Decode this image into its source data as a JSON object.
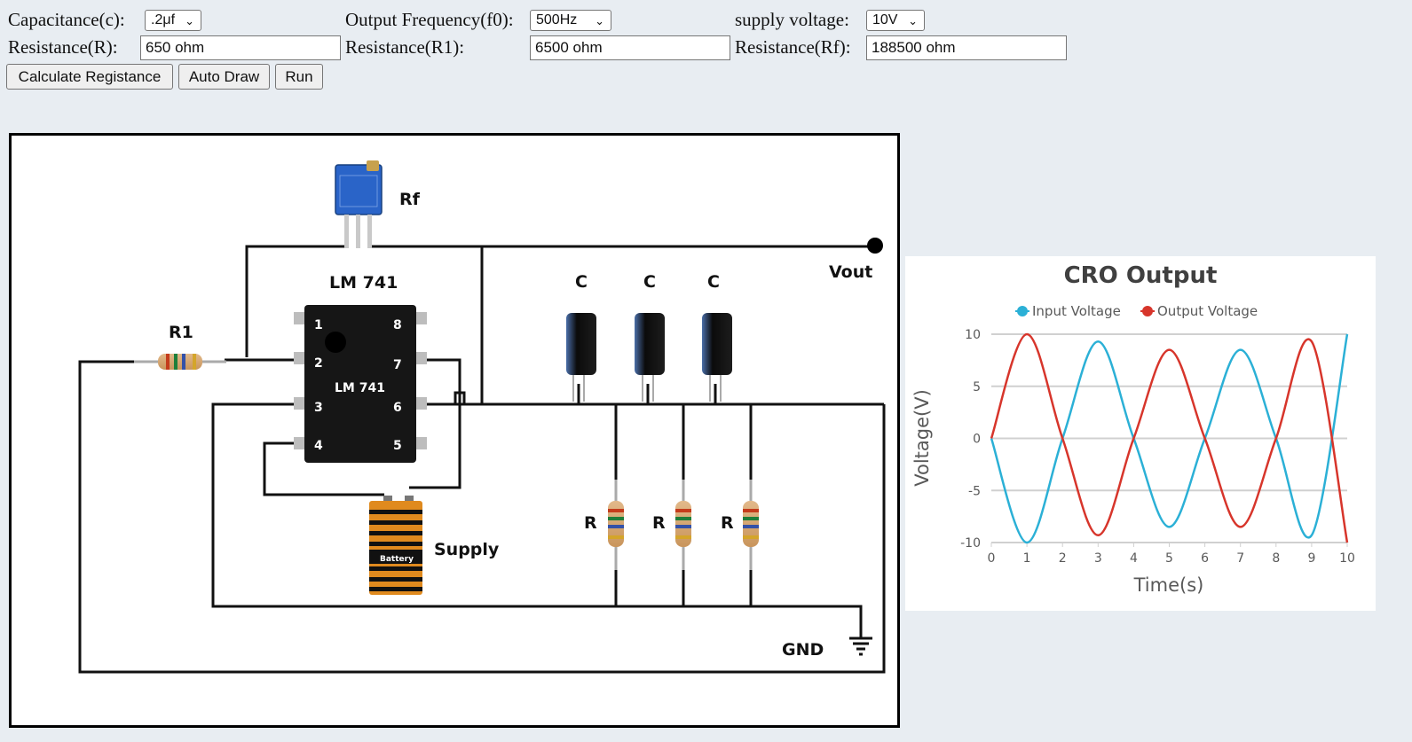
{
  "controls": {
    "capacitance": {
      "label": "Capacitance(c):",
      "value": ".2μf"
    },
    "frequency": {
      "label": "Output Frequency(f0):",
      "value": "500Hz"
    },
    "voltage": {
      "label": "supply voltage:",
      "value": "10V"
    },
    "resistance_r": {
      "label": "Resistance(R):",
      "value": "650 ohm"
    },
    "resistance_r1": {
      "label": "Resistance(R1):",
      "value": "6500 ohm"
    },
    "resistance_rf": {
      "label": "Resistance(Rf):",
      "value": "188500 ohm"
    }
  },
  "buttons": {
    "calculate": "Calculate Registance",
    "auto_draw": "Auto Draw",
    "run": "Run"
  },
  "circuit": {
    "rf_label": "Rf",
    "ic_title": "LM 741",
    "ic_body": "LM 741",
    "pins_left": [
      "1",
      "2",
      "3",
      "4"
    ],
    "pins_right": [
      "8",
      "7",
      "6",
      "5"
    ],
    "r1_label": "R1",
    "vout_label": "Vout",
    "c_labels": [
      "C",
      "C",
      "C"
    ],
    "r_labels": [
      "R",
      "R",
      "R"
    ],
    "supply_label": "Supply",
    "battery_text": "Battery",
    "gnd_label": "GND"
  },
  "chart_data": {
    "type": "line",
    "title": "CRO Output",
    "xlabel": "Time(s)",
    "ylabel": "Voltage(V)",
    "xlim": [
      0,
      10
    ],
    "ylim": [
      -10,
      10
    ],
    "xticks": [
      "0",
      "1",
      "2",
      "3",
      "4",
      "5",
      "6",
      "7",
      "8",
      "9",
      "10"
    ],
    "yticks": [
      "10",
      "5",
      "0",
      "-5",
      "-10"
    ],
    "grid": true,
    "legend_position": "top",
    "series": [
      {
        "name": "Input Voltage",
        "color": "#2bb0d6",
        "x": [
          0,
          1,
          2,
          3,
          4,
          5,
          6,
          7,
          8,
          9,
          10
        ],
        "y": [
          0,
          -10,
          0,
          9.3,
          0,
          -8.5,
          0,
          8.5,
          0,
          -9.3,
          10
        ]
      },
      {
        "name": "Output Voltage",
        "color": "#d7352b",
        "x": [
          0,
          1,
          2,
          3,
          4,
          5,
          6,
          7,
          8,
          9,
          10
        ],
        "y": [
          0,
          10,
          0,
          -9.3,
          0,
          8.5,
          0,
          -8.5,
          0,
          9.3,
          -10
        ]
      }
    ]
  }
}
